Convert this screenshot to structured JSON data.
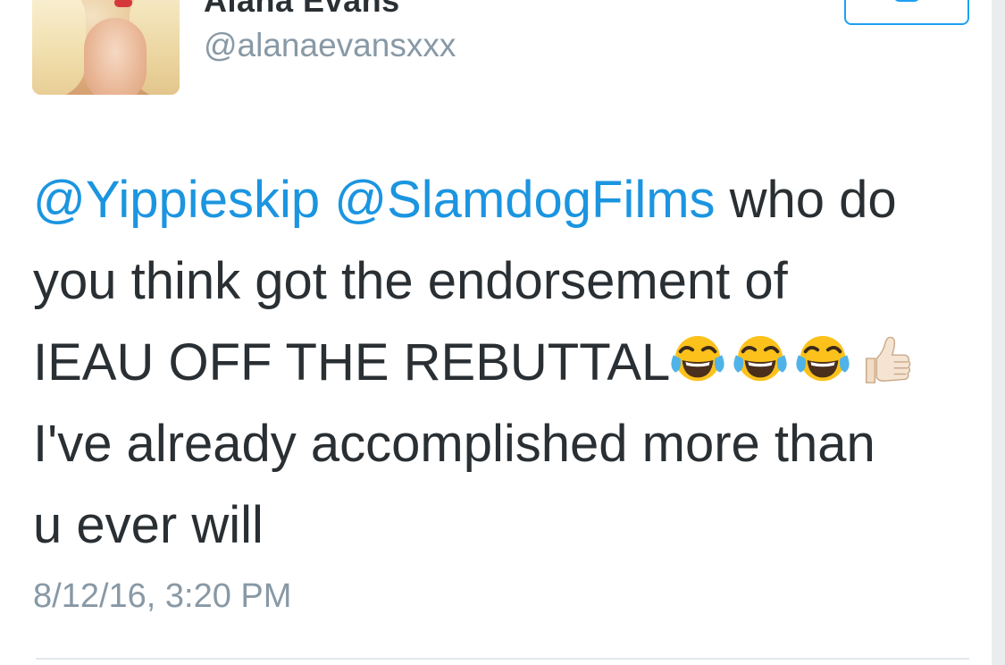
{
  "user": {
    "display_name": "Alana Evans",
    "handle": "@alanaevansxxx"
  },
  "tweet": {
    "line1": {
      "mention1": "@Yippieskip",
      "mention2": "@SlamdogFilms",
      "text": " who do"
    },
    "line2": "you think got the endorsement of",
    "line3": "IEAU OFF THE REBUTTAL",
    "line4": "I've already accomplished more than",
    "line5": "u ever will",
    "emojis": [
      "face-with-tears-of-joy-icon",
      "face-with-tears-of-joy-icon",
      "face-with-tears-of-joy-icon",
      "thumbs-up-light-skin-icon"
    ],
    "timestamp": "8/12/16, 3:20 PM"
  },
  "colors": {
    "mention": "#1b95e0",
    "text": "#292f33",
    "muted": "#8899a6",
    "accent": "#1da1f2"
  }
}
